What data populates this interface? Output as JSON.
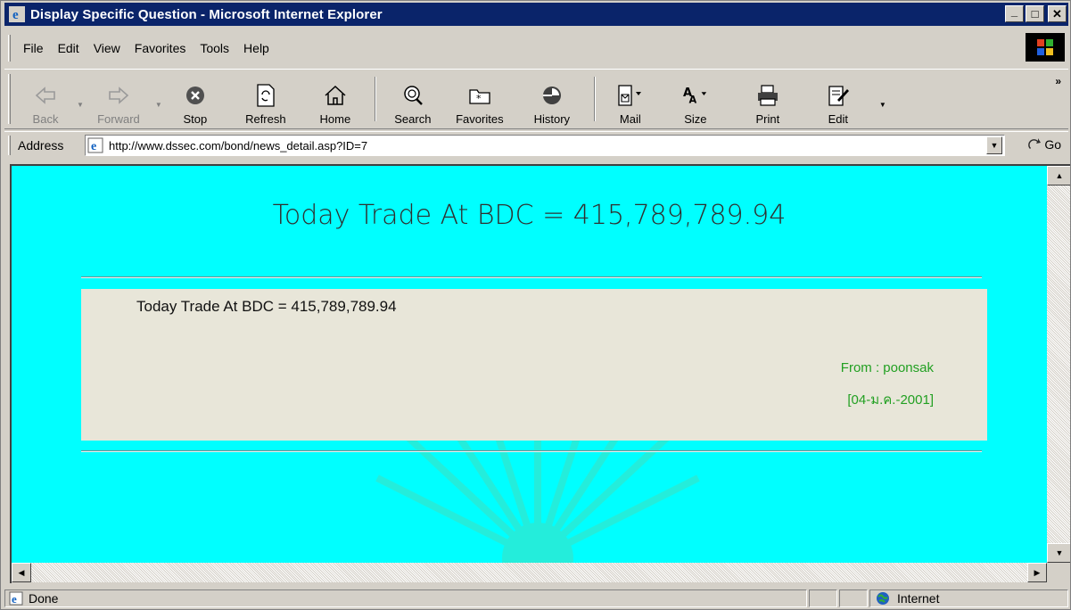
{
  "window": {
    "title": "Display Specific Question - Microsoft Internet Explorer",
    "minimize_glyph": "_",
    "maximize_glyph": "□",
    "close_glyph": "✕"
  },
  "menu": {
    "items": [
      "File",
      "Edit",
      "View",
      "Favorites",
      "Tools",
      "Help"
    ]
  },
  "toolbar": {
    "back": "Back",
    "forward": "Forward",
    "stop": "Stop",
    "refresh": "Refresh",
    "home": "Home",
    "search": "Search",
    "favorites": "Favorites",
    "history": "History",
    "mail": "Mail",
    "size": "Size",
    "print": "Print",
    "edit": "Edit",
    "more_glyph": "»"
  },
  "address": {
    "label": "Address",
    "url": "http://www.dssec.com/bond/news_detail.asp?ID=7",
    "go_label": "Go"
  },
  "page": {
    "headline": "Today Trade At BDC = 415,789,789.94",
    "message": "Today Trade At BDC = 415,789,789.94",
    "from": "From : poonsak",
    "date": "[04-ม.ค.-2001]"
  },
  "status": {
    "text": "Done",
    "zone": "Internet"
  }
}
